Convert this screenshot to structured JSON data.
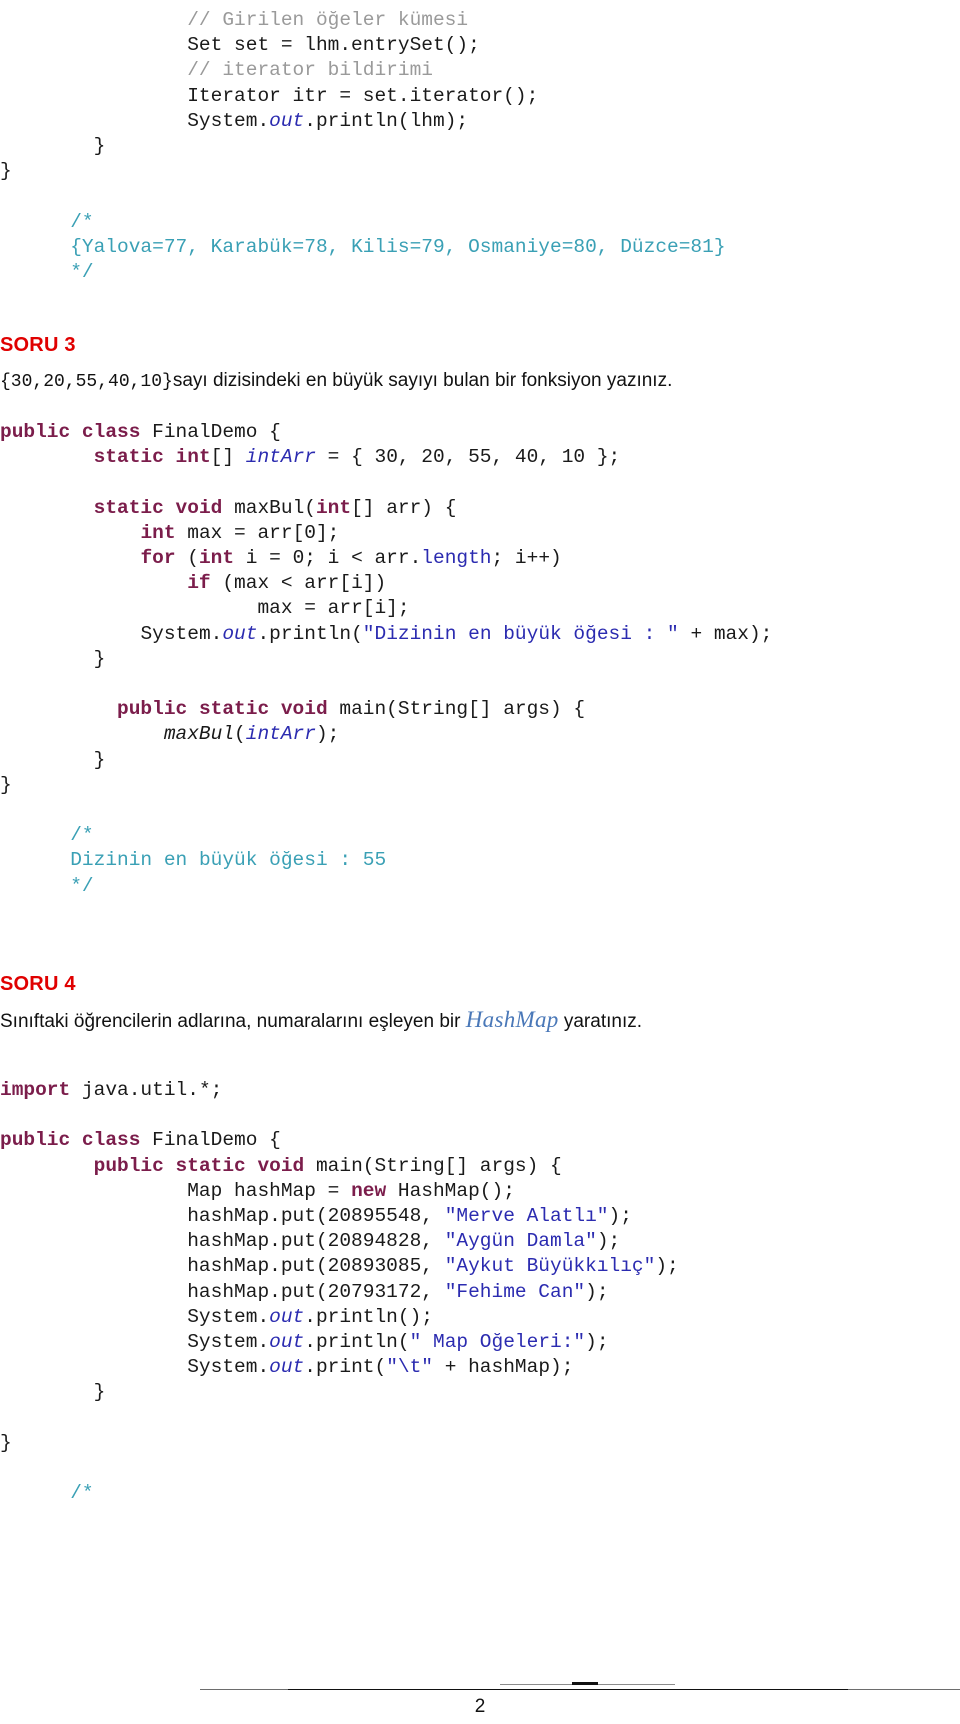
{
  "document": {
    "page_number": "2",
    "language": "tr"
  },
  "colors": {
    "heading_red": "#e00000",
    "keyword_maroon": "#7b1d4b",
    "string_blue": "#2b2bb0",
    "comment_teal": "#3aa0b5",
    "comment_grey": "#9a9a9a",
    "hashmap_blue": "#4a78b8",
    "body_black": "#111111"
  },
  "top_code": {
    "lines": [
      {
        "indent": 8,
        "tokens": [
          {
            "t": "// Girilen öğeler kümesi",
            "c": "cmtg"
          }
        ]
      },
      {
        "indent": 8,
        "tokens": [
          {
            "t": "Set set = lhm.entrySet();",
            "c": "ident"
          }
        ]
      },
      {
        "indent": 8,
        "tokens": [
          {
            "t": "// iterator bildirimi",
            "c": "cmtg"
          }
        ]
      },
      {
        "indent": 8,
        "tokens": [
          {
            "t": "Iterator itr = set.iterator();",
            "c": "ident"
          }
        ]
      },
      {
        "indent": 8,
        "tokens": [
          {
            "t": "System.",
            "c": "ident"
          },
          {
            "t": "out",
            "c": "field"
          },
          {
            "t": ".println(lhm);",
            "c": "ident"
          }
        ]
      },
      {
        "indent": 4,
        "tokens": [
          {
            "t": "}",
            "c": "ident"
          }
        ]
      },
      {
        "indent": 0,
        "tokens": [
          {
            "t": "}",
            "c": "ident"
          }
        ]
      },
      {
        "indent": 0,
        "tokens": [
          {
            "t": "",
            "c": "ident"
          }
        ]
      },
      {
        "indent": 3,
        "tokens": [
          {
            "t": "/*",
            "c": "cmt"
          }
        ]
      },
      {
        "indent": 3,
        "tokens": [
          {
            "t": "{Yalova=77, Karabük=78, Kilis=79, Osmaniye=80, Düzce=81}",
            "c": "cmt"
          }
        ]
      },
      {
        "indent": 3,
        "tokens": [
          {
            "t": "*/",
            "c": "cmt"
          }
        ]
      }
    ]
  },
  "soru3": {
    "heading": "SORU 3",
    "prompt_array": "{30,20,55,40,10}",
    "prompt_text": "sayı dizisindeki en büyük sayıyı bulan bir fonksiyon yazınız.",
    "code_lines": [
      {
        "indent": 0,
        "tokens": [
          {
            "t": "public class ",
            "c": "kw"
          },
          {
            "t": "FinalDemo {",
            "c": "ident"
          }
        ]
      },
      {
        "indent": 4,
        "tokens": [
          {
            "t": "static int",
            "c": "kw"
          },
          {
            "t": "[] ",
            "c": "ident"
          },
          {
            "t": "intArr",
            "c": "fielda"
          },
          {
            "t": " = { 30, 20, 55, 40, 10 };",
            "c": "ident"
          }
        ]
      },
      {
        "indent": 0,
        "tokens": [
          {
            "t": "",
            "c": "ident"
          }
        ]
      },
      {
        "indent": 4,
        "tokens": [
          {
            "t": "static void ",
            "c": "kw"
          },
          {
            "t": "maxBul(",
            "c": "ident"
          },
          {
            "t": "int",
            "c": "kw"
          },
          {
            "t": "[] arr) {",
            "c": "ident"
          }
        ]
      },
      {
        "indent": 6,
        "tokens": [
          {
            "t": "int",
            "c": "kw"
          },
          {
            "t": " max = arr[0];",
            "c": "ident"
          }
        ]
      },
      {
        "indent": 6,
        "tokens": [
          {
            "t": "for ",
            "c": "kw"
          },
          {
            "t": "(",
            "c": "ident"
          },
          {
            "t": "int",
            "c": "kw"
          },
          {
            "t": " i = 0; i < arr.",
            "c": "ident"
          },
          {
            "t": "length",
            "c": "member"
          },
          {
            "t": "; i++)",
            "c": "ident"
          }
        ]
      },
      {
        "indent": 8,
        "tokens": [
          {
            "t": "if",
            "c": "kw"
          },
          {
            "t": " (max < arr[i])",
            "c": "ident"
          }
        ]
      },
      {
        "indent": 11,
        "tokens": [
          {
            "t": "max = arr[i];",
            "c": "ident"
          }
        ]
      },
      {
        "indent": 6,
        "tokens": [
          {
            "t": "System.",
            "c": "ident"
          },
          {
            "t": "out",
            "c": "field"
          },
          {
            "t": ".println(",
            "c": "ident"
          },
          {
            "t": "\"Dizinin en büyük öğesi : \"",
            "c": "str"
          },
          {
            "t": " + max);",
            "c": "ident"
          }
        ]
      },
      {
        "indent": 4,
        "tokens": [
          {
            "t": "}",
            "c": "ident"
          }
        ]
      },
      {
        "indent": 0,
        "tokens": [
          {
            "t": "",
            "c": "ident"
          }
        ]
      },
      {
        "indent": 5,
        "tokens": [
          {
            "t": "public static void ",
            "c": "kw"
          },
          {
            "t": "main(String[] args) {",
            "c": "ident"
          }
        ]
      },
      {
        "indent": 7,
        "tokens": [
          {
            "t": "maxBul",
            "c": "method-i"
          },
          {
            "t": "(",
            "c": "ident"
          },
          {
            "t": "intArr",
            "c": "fielda"
          },
          {
            "t": ");",
            "c": "ident"
          }
        ]
      },
      {
        "indent": 4,
        "tokens": [
          {
            "t": "}",
            "c": "ident"
          }
        ]
      },
      {
        "indent": 0,
        "tokens": [
          {
            "t": "}",
            "c": "ident"
          }
        ]
      },
      {
        "indent": 0,
        "tokens": [
          {
            "t": "",
            "c": "ident"
          }
        ]
      },
      {
        "indent": 3,
        "tokens": [
          {
            "t": "/*",
            "c": "cmt"
          }
        ]
      },
      {
        "indent": 3,
        "tokens": [
          {
            "t": "Dizinin en büyük öğesi : 55",
            "c": "cmt"
          }
        ]
      },
      {
        "indent": 3,
        "tokens": [
          {
            "t": "*/",
            "c": "cmt"
          }
        ]
      }
    ],
    "output_value": "55"
  },
  "soru4": {
    "heading": "SORU 4",
    "prompt_before": "Sınıftaki öğrencilerin adlarına, numaralarını eşleyen bir ",
    "prompt_keyword": "HashMap",
    "prompt_after": " yaratınız.",
    "students": [
      {
        "number": "20895548",
        "name": "Merve Alatlı"
      },
      {
        "number": "20894828",
        "name": "Aygün Damla"
      },
      {
        "number": "20893085",
        "name": "Aykut Büyükkılıç"
      },
      {
        "number": "20793172",
        "name": "Fehime Can"
      }
    ],
    "code_lines": [
      {
        "indent": 0,
        "tokens": [
          {
            "t": "import ",
            "c": "kw"
          },
          {
            "t": "java.util.*;",
            "c": "ident"
          }
        ]
      },
      {
        "indent": 0,
        "tokens": [
          {
            "t": "",
            "c": "ident"
          }
        ]
      },
      {
        "indent": 0,
        "tokens": [
          {
            "t": "public class ",
            "c": "kw"
          },
          {
            "t": "FinalDemo {",
            "c": "ident"
          }
        ]
      },
      {
        "indent": 4,
        "tokens": [
          {
            "t": "public static void ",
            "c": "kw"
          },
          {
            "t": "main(String[] args) {",
            "c": "ident"
          }
        ]
      },
      {
        "indent": 8,
        "tokens": [
          {
            "t": "Map hashMap = ",
            "c": "ident"
          },
          {
            "t": "new",
            "c": "kw"
          },
          {
            "t": " HashMap();",
            "c": "ident"
          }
        ]
      },
      {
        "indent": 8,
        "tokens": [
          {
            "t": "hashMap.put(20895548, ",
            "c": "ident"
          },
          {
            "t": "\"Merve Alatlı\"",
            "c": "str"
          },
          {
            "t": ");",
            "c": "ident"
          }
        ]
      },
      {
        "indent": 8,
        "tokens": [
          {
            "t": "hashMap.put(20894828, ",
            "c": "ident"
          },
          {
            "t": "\"Aygün Damla\"",
            "c": "str"
          },
          {
            "t": ");",
            "c": "ident"
          }
        ]
      },
      {
        "indent": 8,
        "tokens": [
          {
            "t": "hashMap.put(20893085, ",
            "c": "ident"
          },
          {
            "t": "\"Aykut Büyükkılıç\"",
            "c": "str"
          },
          {
            "t": ");",
            "c": "ident"
          }
        ]
      },
      {
        "indent": 8,
        "tokens": [
          {
            "t": "hashMap.put(20793172, ",
            "c": "ident"
          },
          {
            "t": "\"Fehime Can\"",
            "c": "str"
          },
          {
            "t": ");",
            "c": "ident"
          }
        ]
      },
      {
        "indent": 8,
        "tokens": [
          {
            "t": "System.",
            "c": "ident"
          },
          {
            "t": "out",
            "c": "field"
          },
          {
            "t": ".println();",
            "c": "ident"
          }
        ]
      },
      {
        "indent": 8,
        "tokens": [
          {
            "t": "System.",
            "c": "ident"
          },
          {
            "t": "out",
            "c": "field"
          },
          {
            "t": ".println(",
            "c": "ident"
          },
          {
            "t": "\" Map Oğeleri:\"",
            "c": "str"
          },
          {
            "t": ");",
            "c": "ident"
          }
        ]
      },
      {
        "indent": 8,
        "tokens": [
          {
            "t": "System.",
            "c": "ident"
          },
          {
            "t": "out",
            "c": "field"
          },
          {
            "t": ".print(",
            "c": "ident"
          },
          {
            "t": "\"\\t\"",
            "c": "str"
          },
          {
            "t": " + hashMap);",
            "c": "ident"
          }
        ]
      },
      {
        "indent": 4,
        "tokens": [
          {
            "t": "}",
            "c": "ident"
          }
        ]
      },
      {
        "indent": 0,
        "tokens": [
          {
            "t": "",
            "c": "ident"
          }
        ]
      },
      {
        "indent": 0,
        "tokens": [
          {
            "t": "}",
            "c": "ident"
          }
        ]
      },
      {
        "indent": 0,
        "tokens": [
          {
            "t": "",
            "c": "ident"
          }
        ]
      },
      {
        "indent": 3,
        "tokens": [
          {
            "t": "/*",
            "c": "cmt"
          }
        ]
      }
    ]
  }
}
